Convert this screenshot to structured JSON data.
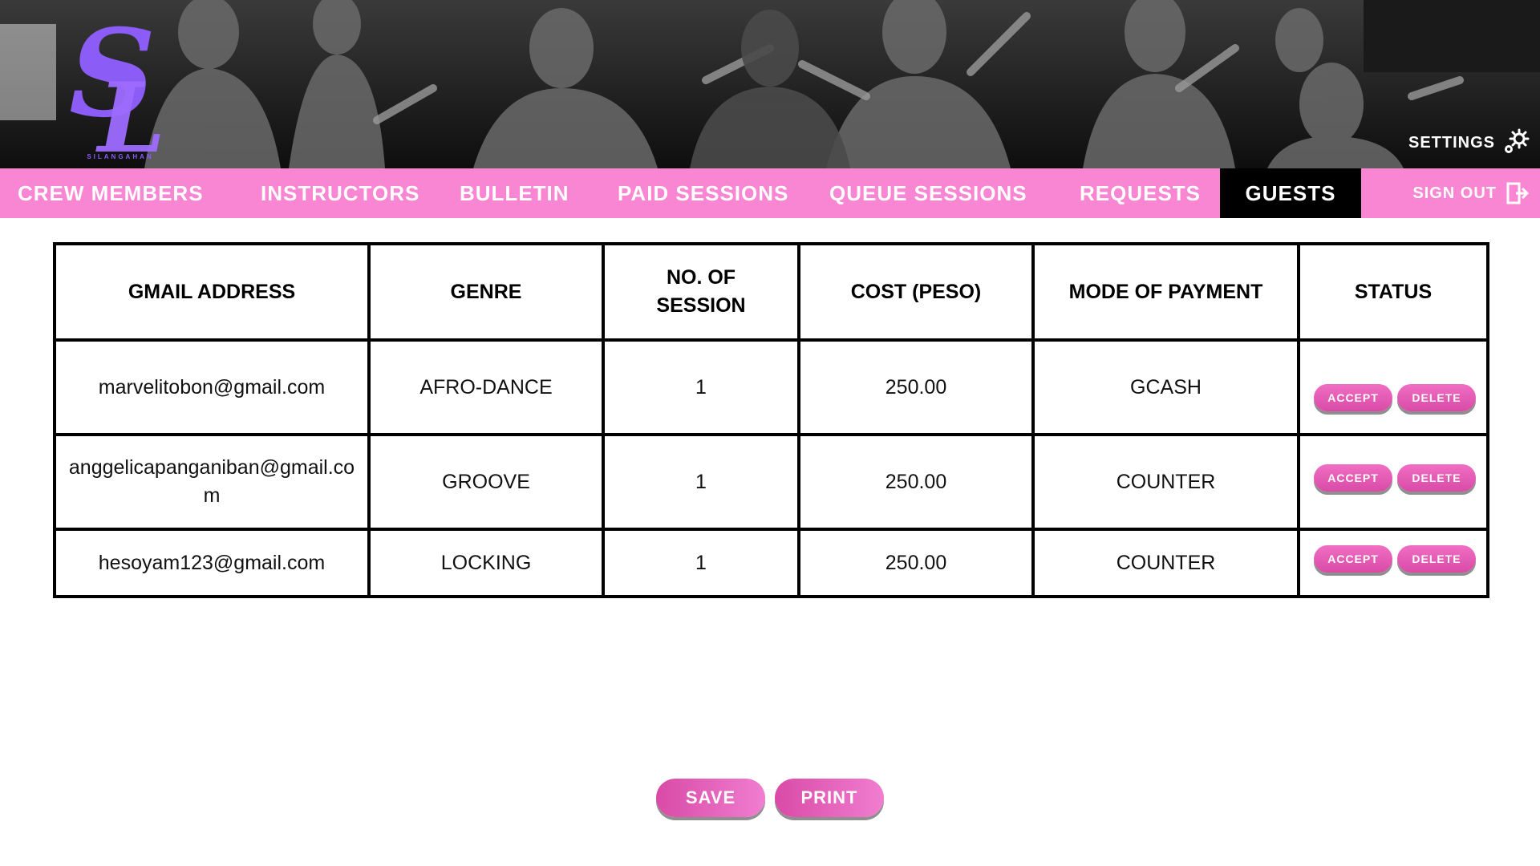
{
  "brand": {
    "logo_text": "SL",
    "wordmark": "SILANGAHAN",
    "logo_color": "#8b5cf6"
  },
  "header": {
    "settings_label": "SETTINGS",
    "settings_icon": "gear-icon"
  },
  "nav": {
    "items": [
      {
        "label": "CREW MEMBERS"
      },
      {
        "label": "INSTRUCTORS"
      },
      {
        "label": "BULLETIN"
      },
      {
        "label": "PAID SESSIONS"
      },
      {
        "label": "QUEUE SESSIONS"
      },
      {
        "label": "REQUESTS"
      },
      {
        "label": "GUESTS",
        "active": true
      }
    ],
    "sign_out_label": "SIGN OUT",
    "sign_out_icon": "sign-out-icon",
    "bar_color": "#f986d2",
    "active_color": "#000000"
  },
  "table": {
    "headers": [
      "GMAIL ADDRESS",
      "GENRE",
      "NO. OF SESSION",
      "COST (PESO)",
      "MODE OF PAYMENT",
      "STATUS"
    ],
    "rows": [
      {
        "email": "marvelitobon@gmail.com",
        "genre": "AFRO-DANCE",
        "sessions": "1",
        "cost": "250.00",
        "payment": "GCASH"
      },
      {
        "email": "anggelicapanganiban@gmail.com",
        "genre": "GROOVE",
        "sessions": "1",
        "cost": "250.00",
        "payment": "COUNTER"
      },
      {
        "email": "hesoyam123@gmail.com",
        "genre": "LOCKING",
        "sessions": "1",
        "cost": "250.00",
        "payment": "COUNTER"
      }
    ],
    "accept_label": "ACCEPT",
    "delete_label": "DELETE"
  },
  "actions": {
    "save_label": "SAVE",
    "print_label": "PRINT",
    "button_color": "#d94aa6"
  }
}
